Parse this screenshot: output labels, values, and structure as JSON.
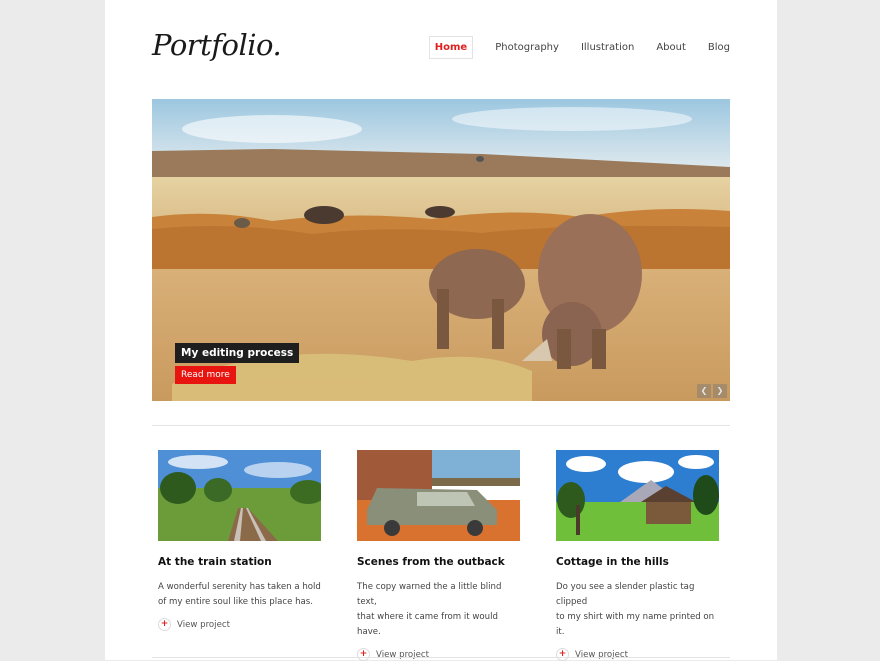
{
  "header": {
    "logo": "Portfolio.",
    "nav": [
      "Home",
      "Photography",
      "Illustration",
      "About",
      "Blog"
    ]
  },
  "hero": {
    "title": "My editing process",
    "button": "Read more",
    "prev_icon": "chevron-left-icon",
    "next_icon": "chevron-right-icon"
  },
  "cards": [
    {
      "title": "At the train station",
      "text": [
        "A wonderful serenity has taken a hold",
        "of my entire soul like this place has."
      ],
      "link": "View project"
    },
    {
      "title": "Scenes from the outback",
      "text": [
        "The copy warned the a little blind text,",
        "that where it came from it would have."
      ],
      "link": "View project"
    },
    {
      "title": "Cottage in the hills",
      "text": [
        "Do you see a slender plastic tag clipped",
        "to my shirt with my name printed on it."
      ],
      "link": "View project"
    }
  ],
  "colors": {
    "accent": "#e8140f",
    "background": "#ebebeb",
    "page": "#ffffff"
  }
}
